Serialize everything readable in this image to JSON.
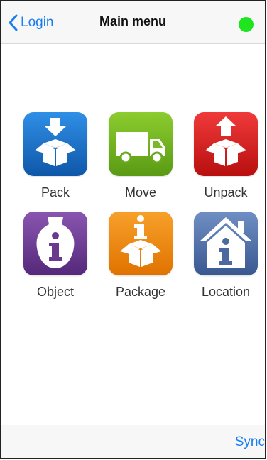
{
  "navbar": {
    "back_label": "Login",
    "title": "Main menu",
    "status_color": "#1ee51e"
  },
  "menu": {
    "items": [
      {
        "label": "Pack",
        "icon": "pack-box-icon",
        "color": "#1a6fc4"
      },
      {
        "label": "Move",
        "icon": "truck-icon",
        "color": "#6fae1e"
      },
      {
        "label": "Unpack",
        "icon": "unpack-box-icon",
        "color": "#d01818"
      },
      {
        "label": "Object",
        "icon": "object-info-icon",
        "color": "#6a3a8e"
      },
      {
        "label": "Package",
        "icon": "package-info-icon",
        "color": "#ee8a0c"
      },
      {
        "label": "Location",
        "icon": "location-house-icon",
        "color": "#4a6aa0"
      }
    ]
  },
  "toolbar": {
    "sync_label": "Sync"
  }
}
